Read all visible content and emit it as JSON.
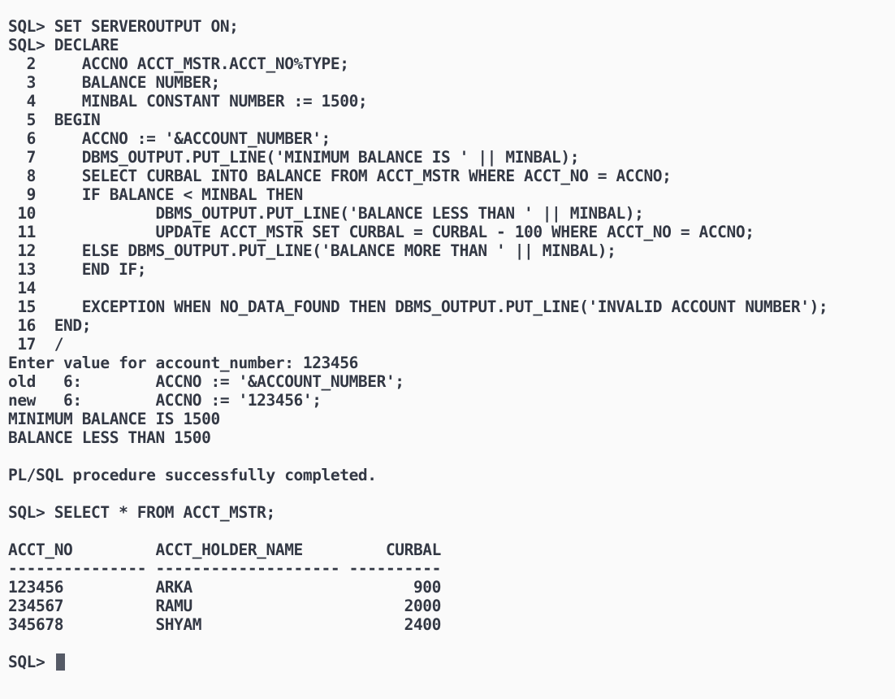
{
  "colors": {
    "background": "#fafafa",
    "text": "#333844",
    "cursor": "#555a66"
  },
  "terminal": {
    "lines": [
      "SQL> SET SERVEROUTPUT ON;",
      "SQL> DECLARE",
      "  2     ACCNO ACCT_MSTR.ACCT_NO%TYPE;",
      "  3     BALANCE NUMBER;",
      "  4     MINBAL CONSTANT NUMBER := 1500;",
      "  5  BEGIN",
      "  6     ACCNO := '&ACCOUNT_NUMBER';",
      "  7     DBMS_OUTPUT.PUT_LINE('MINIMUM BALANCE IS ' || MINBAL);",
      "  8     SELECT CURBAL INTO BALANCE FROM ACCT_MSTR WHERE ACCT_NO = ACCNO;",
      "  9     IF BALANCE < MINBAL THEN",
      " 10             DBMS_OUTPUT.PUT_LINE('BALANCE LESS THAN ' || MINBAL);",
      " 11             UPDATE ACCT_MSTR SET CURBAL = CURBAL - 100 WHERE ACCT_NO = ACCNO;",
      " 12     ELSE DBMS_OUTPUT.PUT_LINE('BALANCE MORE THAN ' || MINBAL);",
      " 13     END IF;",
      " 14",
      " 15     EXCEPTION WHEN NO_DATA_FOUND THEN DBMS_OUTPUT.PUT_LINE('INVALID ACCOUNT NUMBER');",
      " 16  END;",
      " 17  /",
      "Enter value for account_number: 123456",
      "old   6:        ACCNO := '&ACCOUNT_NUMBER';",
      "new   6:        ACCNO := '123456';",
      "MINIMUM BALANCE IS 1500",
      "BALANCE LESS THAN 1500",
      "",
      "PL/SQL procedure successfully completed.",
      "",
      "SQL> SELECT * FROM ACCT_MSTR;",
      "",
      "ACCT_NO         ACCT_HOLDER_NAME         CURBAL",
      "--------------- -------------------- ----------",
      "123456          ARKA                        900",
      "234567          RAMU                       2000",
      "345678          SHYAM                      2400",
      ""
    ],
    "prompt": "SQL> "
  }
}
